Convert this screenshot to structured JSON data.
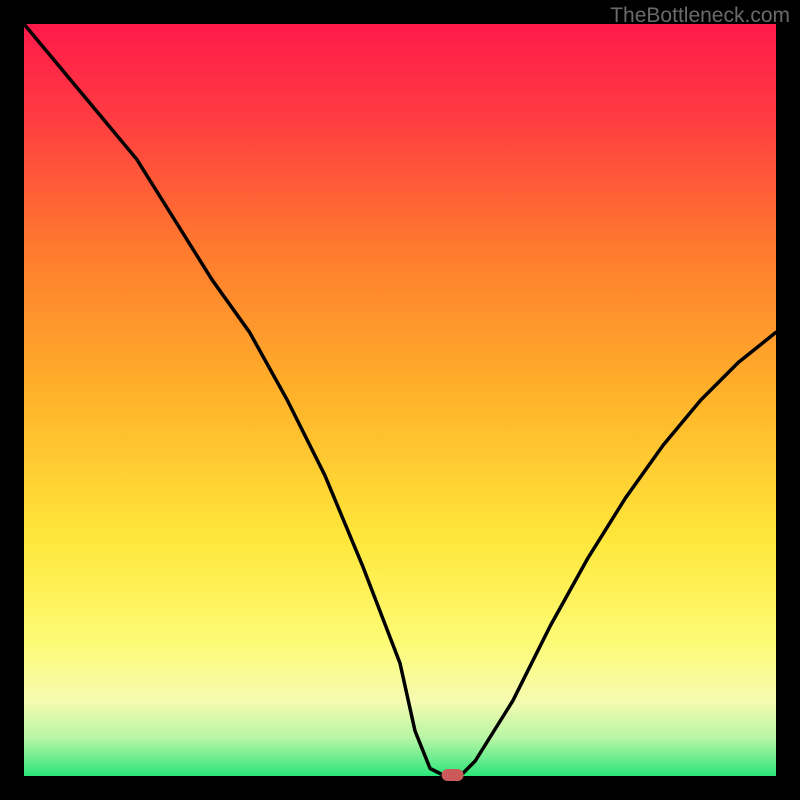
{
  "watermark": "TheBottleneck.com",
  "chart_data": {
    "type": "line",
    "title": "",
    "xlabel": "",
    "ylabel": "",
    "xlim": [
      0,
      100
    ],
    "ylim": [
      0,
      100
    ],
    "grid": false,
    "legend": false,
    "background": "gradient-red-yellow-green",
    "series": [
      {
        "name": "bottleneck-curve",
        "x": [
          0,
          5,
          10,
          15,
          20,
          25,
          30,
          35,
          40,
          45,
          50,
          52,
          54,
          56,
          58,
          60,
          65,
          70,
          75,
          80,
          85,
          90,
          95,
          100
        ],
        "y": [
          100,
          94,
          88,
          82,
          74,
          66,
          59,
          50,
          40,
          28,
          15,
          6,
          1,
          0,
          0,
          2,
          10,
          20,
          29,
          37,
          44,
          50,
          55,
          59
        ],
        "color": "#000000"
      }
    ],
    "marker": {
      "name": "optimal-point",
      "x": 57,
      "y": 0,
      "color": "#cc5a5a"
    }
  }
}
